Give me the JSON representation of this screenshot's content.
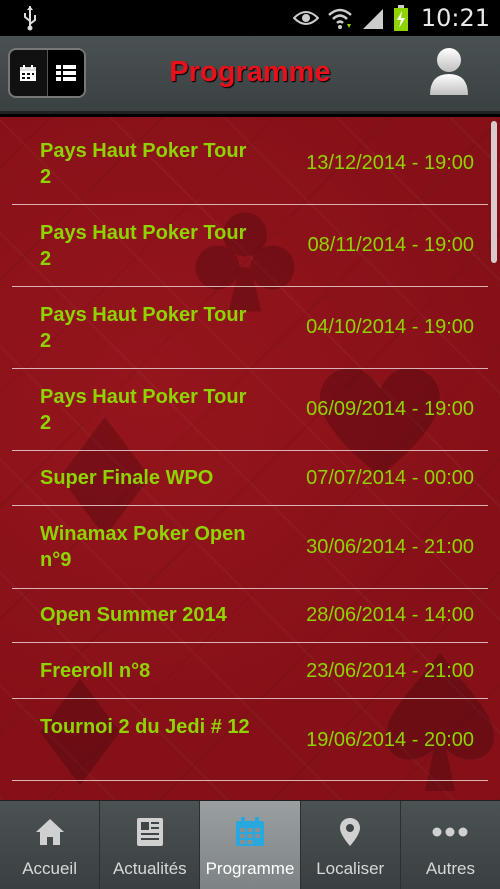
{
  "status_bar": {
    "time": "10:21"
  },
  "header": {
    "title": "Programme"
  },
  "events": [
    {
      "name": "Pays Haut Poker Tour 2",
      "date": "13/12/2014 - 19:00"
    },
    {
      "name": "Pays Haut Poker Tour 2",
      "date": "08/11/2014 - 19:00"
    },
    {
      "name": "Pays Haut Poker Tour 2",
      "date": "04/10/2014 - 19:00"
    },
    {
      "name": "Pays Haut Poker Tour 2",
      "date": "06/09/2014 - 19:00"
    },
    {
      "name": "Super Finale WPO",
      "date": "07/07/2014 - 00:00"
    },
    {
      "name": "Winamax Poker Open n°9",
      "date": "30/06/2014 - 21:00"
    },
    {
      "name": "Open Summer 2014",
      "date": "28/06/2014 - 14:00"
    },
    {
      "name": "Freeroll n°8",
      "date": "23/06/2014 - 21:00"
    },
    {
      "name": "Tournoi 2 du Jedi # 12",
      "date": "19/06/2014 - 20:00"
    }
  ],
  "nav": {
    "tabs": [
      {
        "label": "Accueil",
        "icon": "home-icon"
      },
      {
        "label": "Actualités",
        "icon": "newspaper-icon"
      },
      {
        "label": "Programme",
        "icon": "calendar-icon",
        "active": true
      },
      {
        "label": "Localiser",
        "icon": "location-pin-icon"
      },
      {
        "label": "Autres",
        "icon": "more-dots-icon"
      }
    ]
  },
  "colors": {
    "title": "#e8101a",
    "event_text": "#8fd400",
    "background": "#8c1016",
    "active_tab_icon": "#29a8e0"
  }
}
